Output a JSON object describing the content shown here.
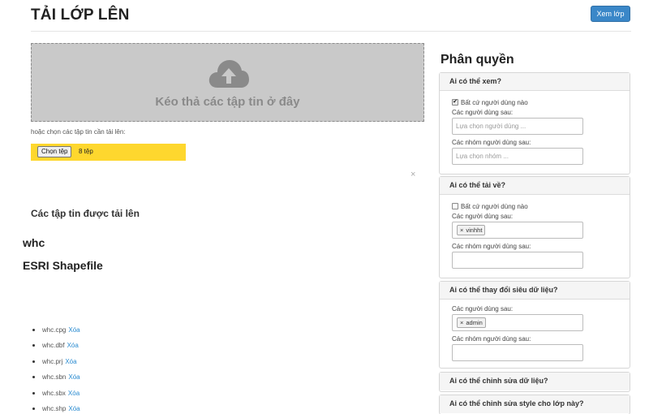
{
  "header": {
    "title": "TẢI LỚP LÊN",
    "view_layer_button": "Xem lớp"
  },
  "upload": {
    "dropzone_text": "Kéo thả các tập tin ở đây",
    "choose_hint": "hoặc chọn các tập tin cần tải lên:",
    "choose_button": "Chọn tệp",
    "file_count": "8 tệp",
    "close": "×",
    "icons": {
      "dropzone": "cloud-upload-icon"
    }
  },
  "uploaded": {
    "title": "Các tập tin được tải lên",
    "layer_name": "whc",
    "layer_type": "ESRI Shapefile",
    "delete_label": "Xóa",
    "files": [
      "whc.cpg",
      "whc.dbf",
      "whc.prj",
      "whc.sbn",
      "whc.sbx",
      "whc.shp"
    ]
  },
  "permissions": {
    "title": "Phân quyền",
    "view": {
      "heading": "Ai có thể xem?",
      "anyone_label": "Bất cứ người dùng nào",
      "anyone_checked": true,
      "users_label": "Các người dùng sau:",
      "users_placeholder": "Lựa chọn người dùng ...",
      "groups_label": "Các nhóm người dùng sau:",
      "groups_placeholder": "Lựa chọn nhóm ..."
    },
    "download": {
      "heading": "Ai có thể tải về?",
      "anyone_label": "Bất cứ người dùng nào",
      "anyone_checked": false,
      "users_label": "Các người dùng sau:",
      "user_tag": "vinhht",
      "groups_label": "Các nhóm người dùng sau:"
    },
    "metadata": {
      "heading": "Ai có thể thay đổi siêu dữ liệu?",
      "users_label": "Các người dùng sau:",
      "user_tag": "admin",
      "groups_label": "Các nhóm người dùng sau:"
    },
    "edit_data": {
      "heading": "Ai có thể chỉnh sửa dữ liệu?"
    },
    "edit_style": {
      "heading": "Ai có thể chỉnh sửa style cho lớp này?"
    },
    "tag_remove": "×",
    "check_mark": "✔"
  },
  "colors": {
    "accent": "#3a87c8",
    "file_bar": "#fed72e",
    "dropzone": "#c9c9c9",
    "link": "#2a8bd0"
  }
}
